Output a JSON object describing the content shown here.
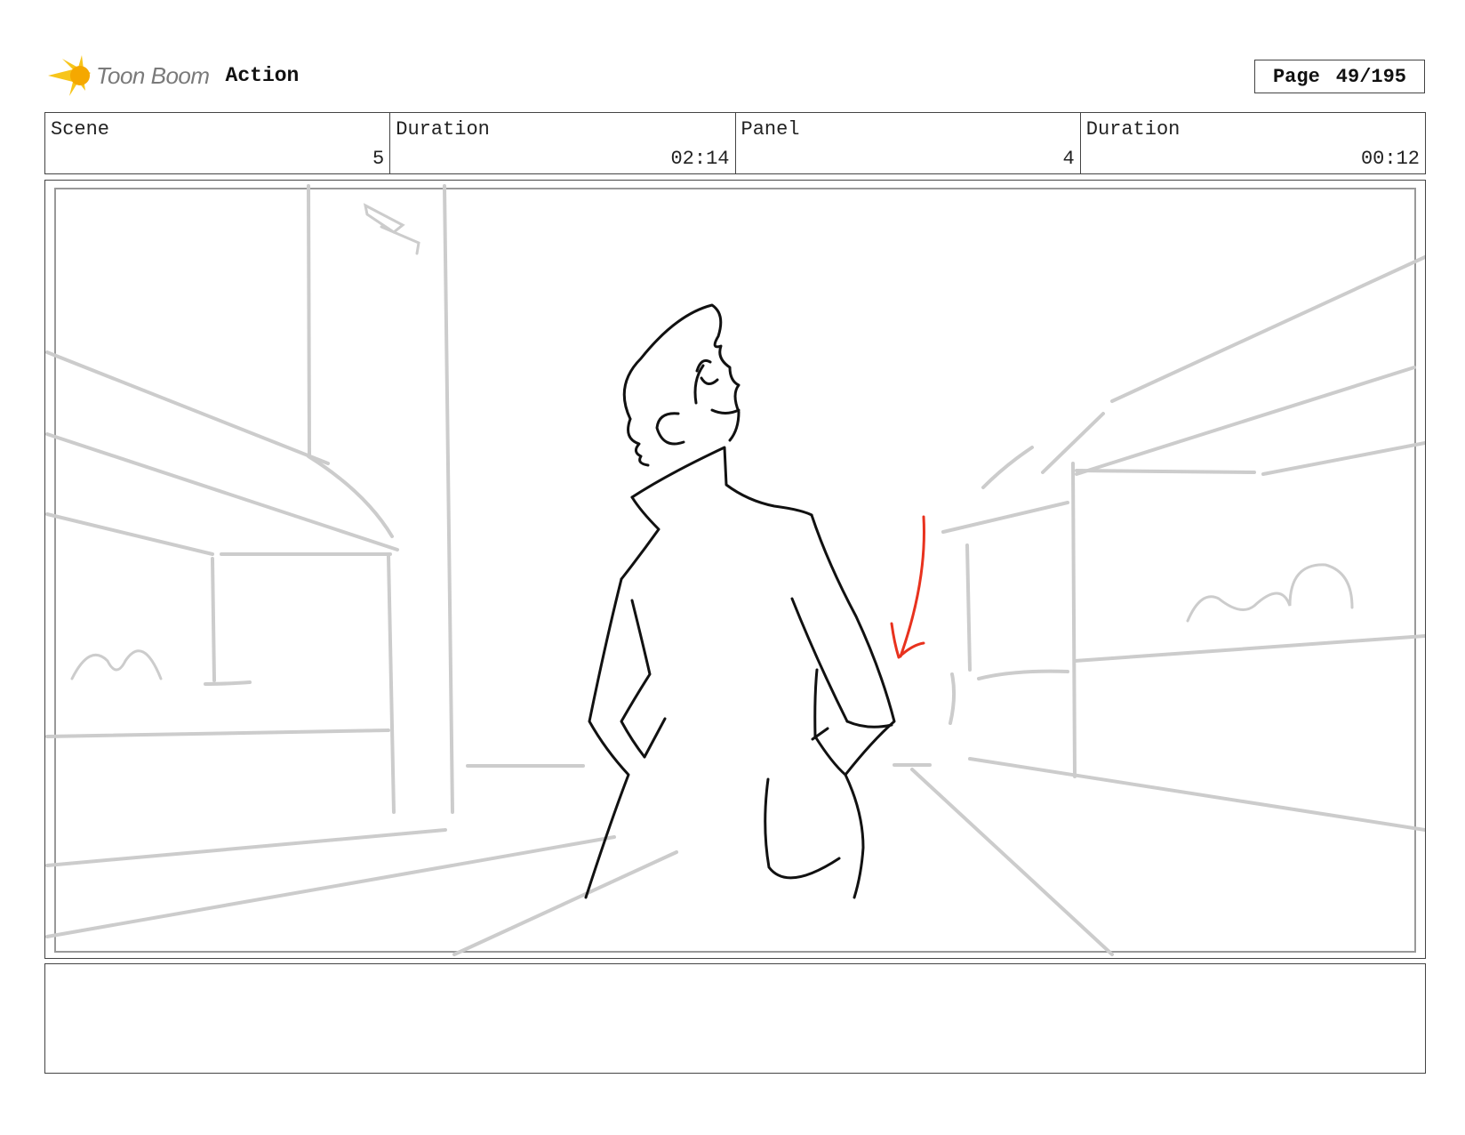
{
  "header": {
    "brand": "Toon Boom",
    "product": "Action",
    "page_label": "Page",
    "page_value": "49/195"
  },
  "info": [
    {
      "label": "Scene",
      "value": "5"
    },
    {
      "label": "Duration",
      "value": "02:14"
    },
    {
      "label": "Panel",
      "value": "4"
    },
    {
      "label": "Duration",
      "value": "00:12"
    }
  ],
  "panel": {
    "sketch_line_color": "#111111",
    "background_line_color": "#cccccc",
    "arrow_color": "#e8321e"
  },
  "notes": {
    "text": ""
  }
}
